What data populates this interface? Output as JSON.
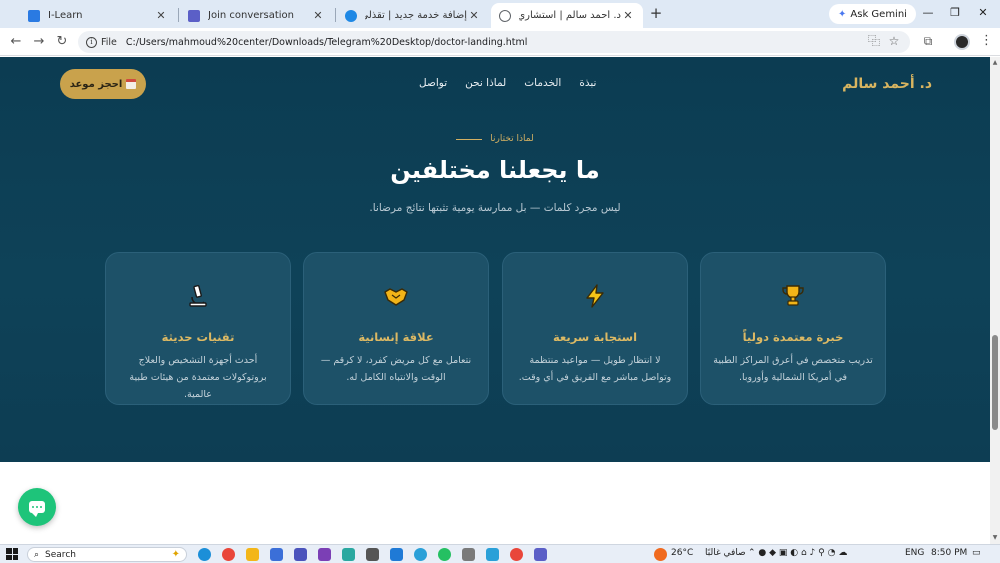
{
  "browser": {
    "tabs": [
      {
        "label": "I-Learn",
        "active": false,
        "favicon_color": "#2a7ae2"
      },
      {
        "label": "Join conversation",
        "active": false,
        "favicon_color": "#5b5fc7"
      },
      {
        "label": "إضافة خدمة جديد | تقذلي",
        "active": false,
        "favicon_color": "#1e88e5"
      },
      {
        "label": "د. أحمد سالم | استشاري القلب والأ",
        "active": true,
        "favicon_color": "#5f6368"
      }
    ],
    "new_tab_glyph": "+",
    "gemini_label": "Ask Gemini",
    "window_controls": [
      "—",
      "❐",
      "✕"
    ],
    "url_chip": "File",
    "url": "C:/Users/mahmoud%20center/Downloads/Telegram%20Desktop/doctor-landing.html"
  },
  "site": {
    "brand": "د. أحمد سالم",
    "nav": [
      "نبذة",
      "الخدمات",
      "لماذا نحن",
      "تواصل"
    ],
    "book_button": "احجز موعد",
    "section": {
      "eyebrow": "لماذا تختارنا",
      "heading": "ما يجعلنا مختلفين",
      "subheading": "ليس مجرد كلمات — بل ممارسة يومية تثبتها نتائج مرضانا."
    },
    "cards": [
      {
        "icon": "trophy-icon",
        "title": "خبرة معتمدة دولياً",
        "desc": "تدريب متخصص في أعرق المراكز الطبية في أمريكا الشمالية وأوروبا."
      },
      {
        "icon": "lightning-icon",
        "title": "استجابة سريعة",
        "desc": "لا انتظار طويل — مواعيد منتظمة وتواصل مباشر مع الفريق في أي وقت."
      },
      {
        "icon": "handshake-icon",
        "title": "علاقة إنسانية",
        "desc": "نتعامل مع كل مريض كفرد، لا كرقم — الوقت والانتباه الكامل له."
      },
      {
        "icon": "microscope-icon",
        "title": "تقنيات حديثة",
        "desc": "أحدث أجهزة التشخيص والعلاج بروتوكولات معتمدة من هيئات طبية عالمية."
      }
    ],
    "colors": {
      "accent": "#c9a24c",
      "section_bg": "#0e4258",
      "card_bg": "#1d5168",
      "chat_fab": "#1ec47a"
    }
  },
  "taskbar": {
    "search_label": "Search",
    "weather": "26°C",
    "weather_text": "صافي غالبًا",
    "lang": "ENG",
    "time": "8:50 PM"
  }
}
